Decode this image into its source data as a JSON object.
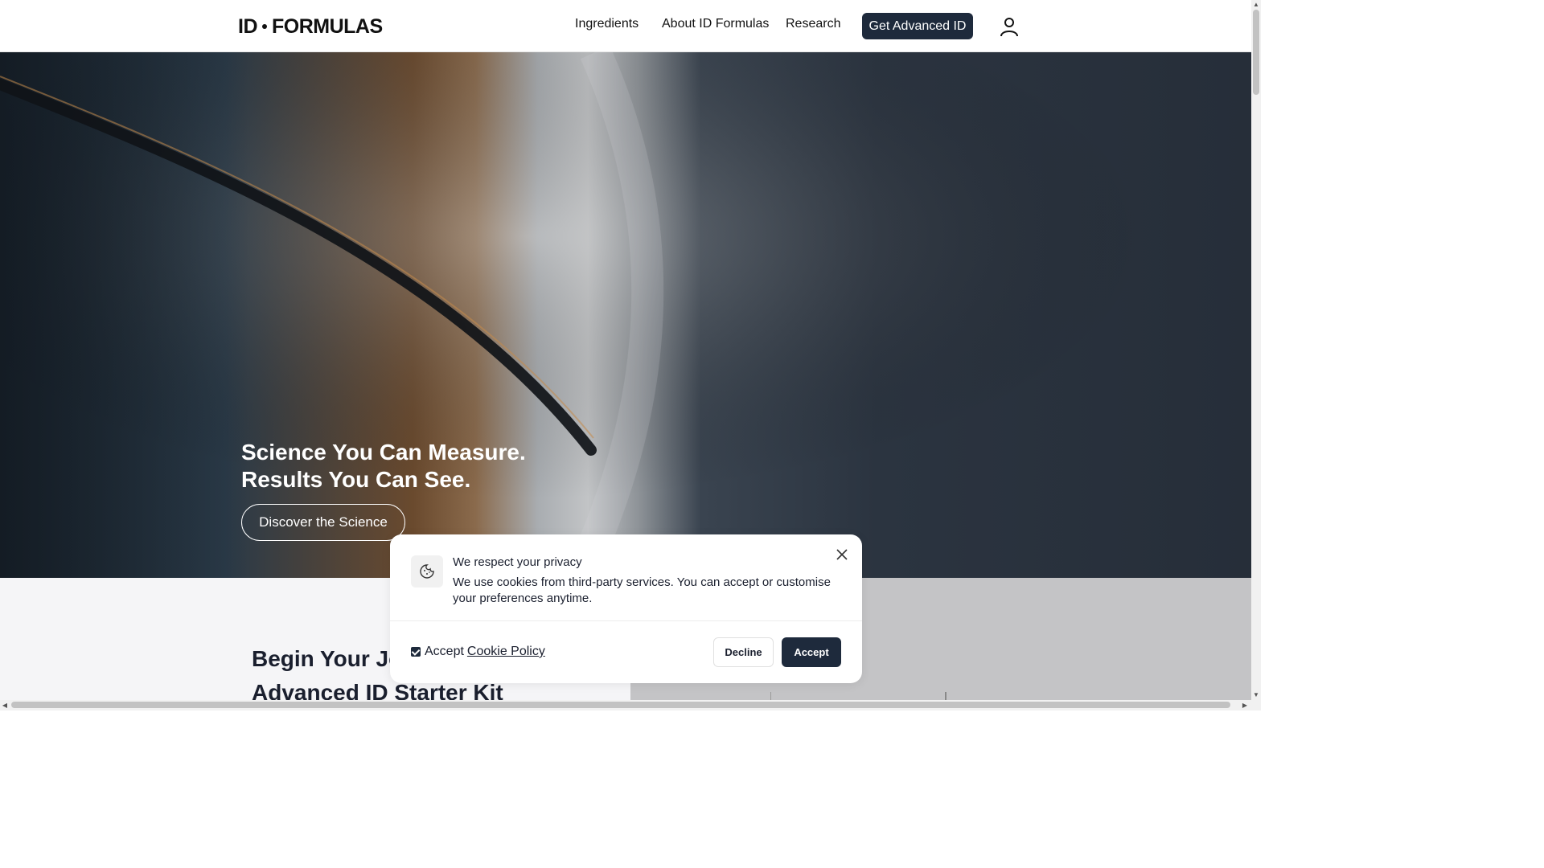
{
  "header": {
    "logo_left": "ID",
    "logo_right": "FORMULAS",
    "nav": [
      {
        "label": "Ingredients"
      },
      {
        "label": "About ID Formulas"
      },
      {
        "label": "Research"
      }
    ],
    "cta_label": "Get Advanced ID",
    "account_icon": "user-icon"
  },
  "hero": {
    "headline_line1": "Science You Can Measure.",
    "headline_line2": "Results You Can See.",
    "button_label": "Discover the Science"
  },
  "section": {
    "heading_line1": "Begin Your Jo",
    "heading_line2": "Advanced ID Starter Kit"
  },
  "cookie_dialog": {
    "icon": "cookie-icon",
    "title": "We respect your privacy",
    "body": "We use cookies from third-party services. You can accept or customise your preferences anytime.",
    "checkbox_checked": true,
    "accept_text": "Accept",
    "policy_link": "Cookie Policy",
    "decline_label": "Decline",
    "accept_label": "Accept"
  },
  "colors": {
    "brand_dark": "#1e2a3c",
    "hero_bg": "#2b3440"
  }
}
